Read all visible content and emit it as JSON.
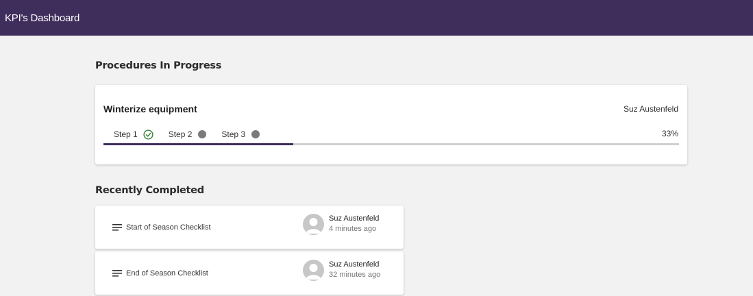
{
  "header": {
    "title": "KPI's Dashboard"
  },
  "in_progress": {
    "heading": "Procedures In Progress",
    "procedure": {
      "title": "Winterize equipment",
      "owner": "Suz Austenfeld",
      "percent_label": "33%",
      "progress": 0.33,
      "steps": [
        {
          "label": "Step 1",
          "status": "complete",
          "icon": "check-circle-icon"
        },
        {
          "label": "Step 2",
          "status": "pending",
          "icon": "dot-icon"
        },
        {
          "label": "Step 3",
          "status": "pending",
          "icon": "dot-icon"
        }
      ]
    }
  },
  "recent": {
    "heading": "Recently Completed",
    "items": [
      {
        "title": "Start of Season Checklist",
        "user": "Suz Austenfeld",
        "time": "4 minutes ago",
        "icon": "list-icon"
      },
      {
        "title": "End of Season Checklist",
        "user": "Suz Austenfeld",
        "time": "32 minutes ago",
        "icon": "list-icon"
      }
    ]
  },
  "colors": {
    "primary": "#3f2d5c",
    "success": "#2e7d32",
    "pending": "#7a7a7a",
    "track": "#cfcfcf"
  }
}
